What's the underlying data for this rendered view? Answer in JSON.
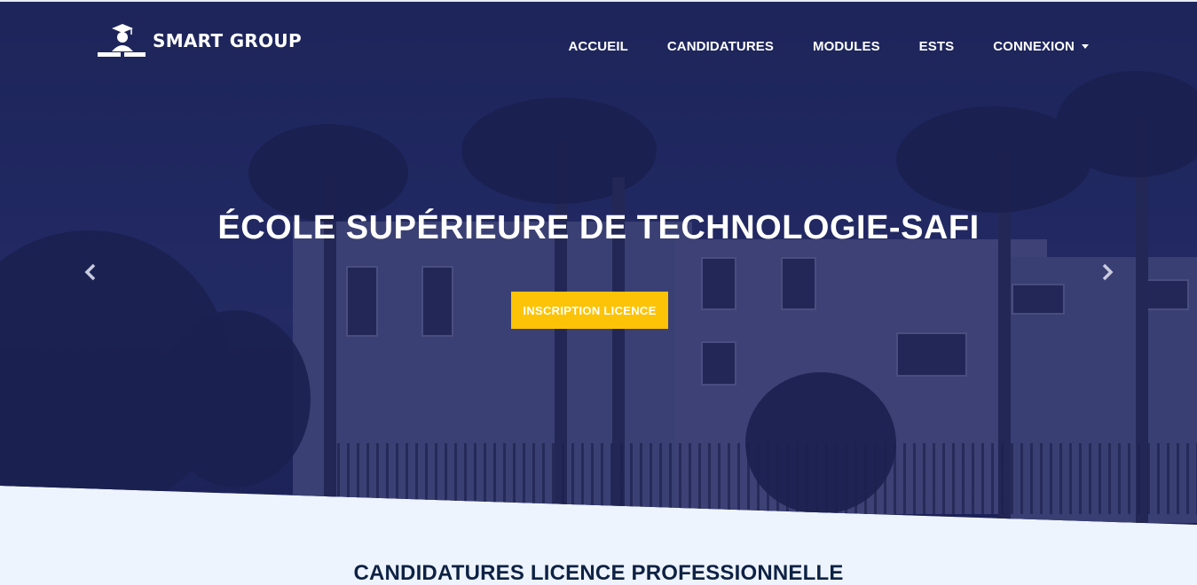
{
  "brand": {
    "name": "SMART GROUP",
    "icon": "graduate-logo-icon"
  },
  "nav": {
    "items": [
      {
        "label": "ACCUEIL"
      },
      {
        "label": "CANDIDATURES"
      },
      {
        "label": "MODULES"
      },
      {
        "label": "ESTS"
      },
      {
        "label": "CONNEXION",
        "icon": "caret-down-icon"
      }
    ]
  },
  "hero": {
    "title": "ÉCOLE SUPÉRIEURE DE TECHNOLOGIE-SAFI",
    "cta_label": "INSCRIPTION LICENCE",
    "prev_icon": "chevron-left-icon",
    "next_icon": "chevron-right-icon"
  },
  "section": {
    "title": "CANDIDATURES LICENCE PROFESSIONNELLE"
  },
  "colors": {
    "accent": "#fcc307",
    "navy": "#1f2a5e",
    "section_bg": "#eef4fd",
    "heading": "#0e2244"
  }
}
